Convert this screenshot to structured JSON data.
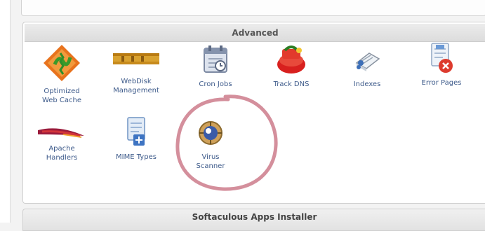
{
  "section": {
    "title": "Advanced",
    "items": [
      {
        "label": "Optimized\nWeb Cache",
        "icon": "cache-optimize-icon"
      },
      {
        "label": "WebDisk\nManagement",
        "icon": "webdisk-icon"
      },
      {
        "label": "Cron Jobs",
        "icon": "cron-calendar-icon"
      },
      {
        "label": "Track DNS",
        "icon": "track-dns-icon"
      },
      {
        "label": "Indexes",
        "icon": "indexes-icon"
      },
      {
        "label": "Error Pages",
        "icon": "error-pages-icon"
      },
      {
        "label": "Apache\nHandlers",
        "icon": "apache-feather-icon"
      },
      {
        "label": "MIME Types",
        "icon": "mime-types-icon"
      },
      {
        "label": "Virus\nScanner",
        "icon": "virus-scanner-icon"
      }
    ]
  },
  "next_section": {
    "title": "Softaculous Apps Installer"
  },
  "annotation": {
    "color": "#d48f9c"
  }
}
